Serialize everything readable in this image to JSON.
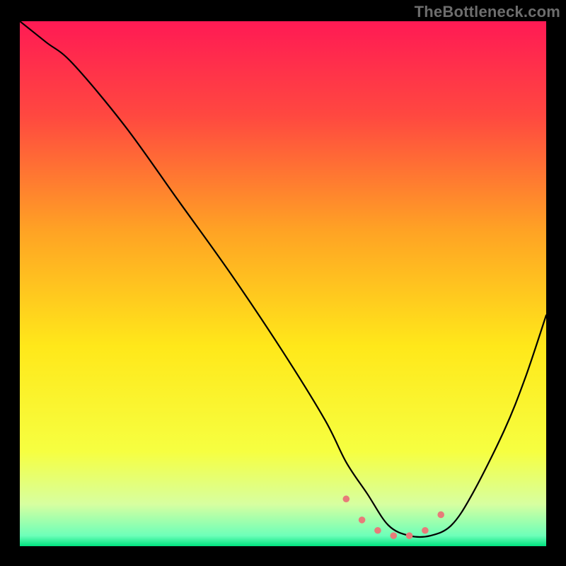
{
  "watermark": "TheBottleneck.com",
  "chart_data": {
    "type": "line",
    "title": "",
    "xlabel": "",
    "ylabel": "",
    "xlim": [
      0,
      100
    ],
    "ylim": [
      0,
      100
    ],
    "grid": false,
    "legend": false,
    "gradient_stops": [
      {
        "offset": 0,
        "color": "#ff1a54"
      },
      {
        "offset": 18,
        "color": "#ff4840"
      },
      {
        "offset": 40,
        "color": "#ffa324"
      },
      {
        "offset": 62,
        "color": "#ffe81a"
      },
      {
        "offset": 82,
        "color": "#f6ff41"
      },
      {
        "offset": 92,
        "color": "#d7ffa0"
      },
      {
        "offset": 98,
        "color": "#6dffb9"
      },
      {
        "offset": 100,
        "color": "#00e27f"
      }
    ],
    "series": [
      {
        "name": "curve",
        "color": "#000000",
        "width": 2.2,
        "x": [
          0,
          5,
          10,
          20,
          30,
          40,
          50,
          58,
          62,
          66,
          70,
          74,
          78,
          82,
          86,
          92,
          96,
          100
        ],
        "y": [
          100,
          96,
          92,
          80,
          66,
          52,
          37,
          24,
          16,
          10,
          4,
          2,
          2,
          4,
          10,
          22,
          32,
          44
        ]
      }
    ],
    "markers": {
      "name": "minimum-band",
      "color": "#e77b79",
      "radius": 4.8,
      "x": [
        62,
        65,
        68,
        71,
        74,
        77,
        80
      ],
      "y": [
        9,
        5,
        3,
        2,
        2,
        3,
        6
      ]
    }
  }
}
